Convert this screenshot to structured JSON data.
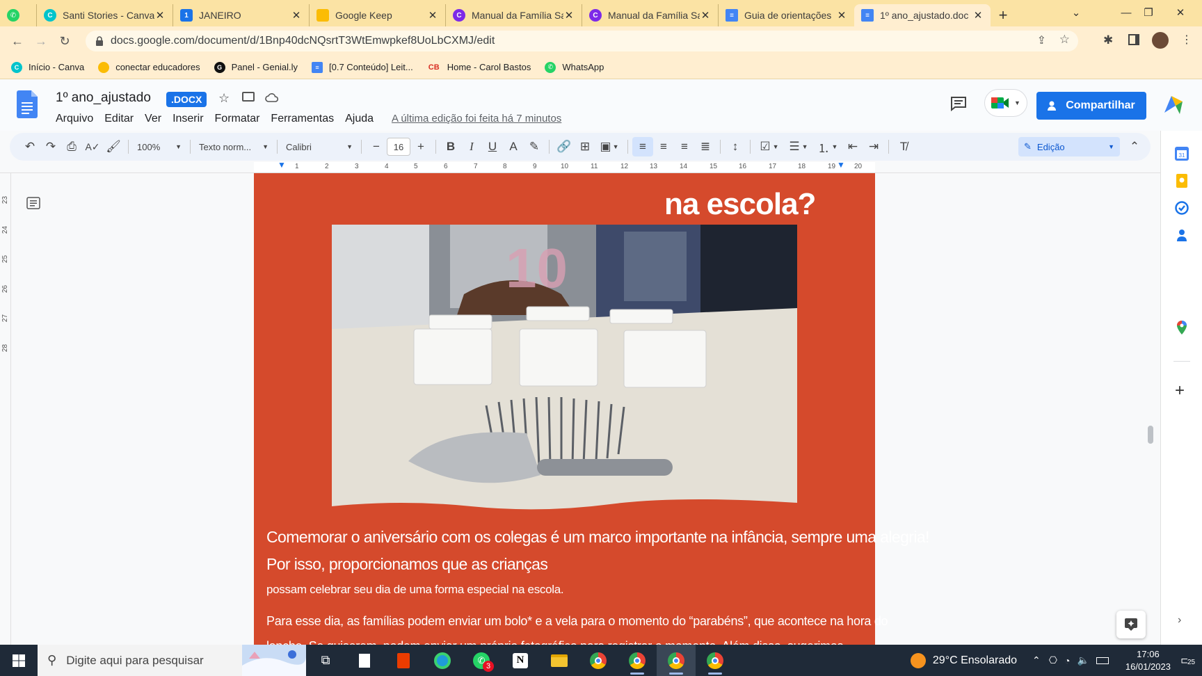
{
  "tabs": [
    {
      "title": "",
      "icon": "whatsapp-icon",
      "color": "#25d366"
    },
    {
      "title": "Santi Stories - Canva",
      "icon": "canva-icon",
      "color": "#00c4cc"
    },
    {
      "title": "JANEIRO",
      "icon": "trello-icon",
      "color": "#1a73e8"
    },
    {
      "title": "Google Keep",
      "icon": "keep-icon",
      "color": "#fbbc04"
    },
    {
      "title": "Manual da Família Sa",
      "icon": "canva-icon",
      "color": "#7d2ae8"
    },
    {
      "title": "Manual da Família Sa",
      "icon": "canva-icon",
      "color": "#7d2ae8"
    },
    {
      "title": "Guia de orientações",
      "icon": "docs-icon",
      "color": "#4285f4"
    },
    {
      "title": "1º ano_ajustado.doc",
      "icon": "docs-icon",
      "color": "#4285f4"
    }
  ],
  "browser": {
    "url": "docs.google.com/document/d/1Bnp40dcNQsrtT3WtEmwpkef8UoLbCXMJ/edit"
  },
  "bookmarks": [
    {
      "label": "Início - Canva",
      "icon": "canva-icon",
      "color": "#00c4cc"
    },
    {
      "label": "conectar educadores",
      "icon": "bulb-icon",
      "color": "#fbbc04"
    },
    {
      "label": "Panel - Genial.ly",
      "icon": "genially-icon",
      "color": "#111111"
    },
    {
      "label": "[0.7 Conteúdo] Leit...",
      "icon": "docs-icon",
      "color": "#4285f4"
    },
    {
      "label": "Home - Carol Bastos",
      "icon": "cb-icon",
      "color": "#d93025"
    },
    {
      "label": "WhatsApp",
      "icon": "whatsapp-icon",
      "color": "#25d366"
    }
  ],
  "doc": {
    "title": "1º ano_ajustado",
    "badge": ".DOCX",
    "menu": [
      "Arquivo",
      "Editar",
      "Ver",
      "Inserir",
      "Formatar",
      "Ferramentas",
      "Ajuda"
    ],
    "last_edit": "A última edição foi feita há 7 minutos",
    "share": "Compartilhar"
  },
  "toolbar": {
    "zoom": "100%",
    "style": "Texto norm...",
    "font": "Calibri",
    "size": "16",
    "mode": "Edição"
  },
  "ruler": [
    "1",
    "2",
    "3",
    "4",
    "5",
    "6",
    "7",
    "8",
    "9",
    "10",
    "11",
    "12",
    "13",
    "14",
    "15",
    "16",
    "17",
    "18",
    "19",
    "20"
  ],
  "vruler": [
    "23",
    "24",
    "25",
    "26",
    "27",
    "28"
  ],
  "page": {
    "heading": "na escola?",
    "para1_line1": "Comemorar o aniversário com os colegas é um marco importante na infância, sempre uma alegria!",
    "para1_line2": "Por isso, proporcionamos que as crianças",
    "para1_line3": "possam celebrar seu dia de uma forma especial na escola.",
    "para2_line1": "Para esse dia, as famílias podem enviar um bolo* e a vela para o momento do “parabéns”, que acontece na hora do",
    "para2_line2": "lanche. Se quiserem, podem enviar um próprio fotográfico para registrar o momento. Além disso, sugerimos"
  },
  "taskbar": {
    "search_placeholder": "Digite aqui para pesquisar",
    "weather": "29°C  Ensolarado",
    "time": "17:06",
    "date": "16/01/2023",
    "whatsapp_badge": "3",
    "notif_count": "25"
  }
}
